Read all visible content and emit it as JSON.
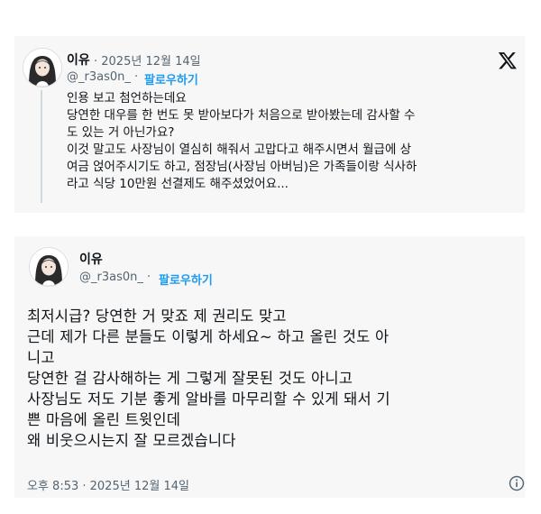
{
  "tweet1": {
    "name": "이유",
    "date": "· 2025년 12월 14일",
    "handle": "@_r3as0n_ ·",
    "follow": "팔로우하기",
    "lines": [
      "인용 보고 첨언하는데요",
      "당연한 대우를 한 번도 못 받아보다가 처음으로 받아봤는데 감사할 수",
      "도 있는 거 아닌가요?",
      "이것 말고도 사장님이 열심히 해줘서 고맙다고 해주시면서 월급에 상",
      "여금 얹어주시기도 하고, 점장님(사장님 아버님)은 가족들이랑 식사하",
      "라고 식당 10만원 선결제도 해주셨었어요..."
    ]
  },
  "tweet2": {
    "name": "이유",
    "handle": "@_r3as0n_ ·",
    "follow": "팔로우하기",
    "lines": [
      "최저시급? 당연한 거 맞죠 제 권리도 맞고",
      "근데 제가 다른 분들도 이렇게 하세요~ 하고 올린 것도 아",
      "니고",
      "당연한 걸 감사해하는 게 그렇게 잘못된 것도 아니고",
      "사장님도 저도 기분 좋게 알바를 마무리할 수 있게 돼서 기",
      "쁜 마음에 올린 트윗인데",
      "왜 비웃으시는지 잘 모르겠습니다"
    ],
    "timestamp": "오후 8:53 · 2025년 12월 14일"
  },
  "icons": {
    "logo": "x-logo-icon",
    "info": "info-icon",
    "avatar": "avatar"
  },
  "colors": {
    "link": "#1d9bf0",
    "muted": "#536471",
    "text": "#0f1419",
    "card": "#f7f7f7"
  }
}
